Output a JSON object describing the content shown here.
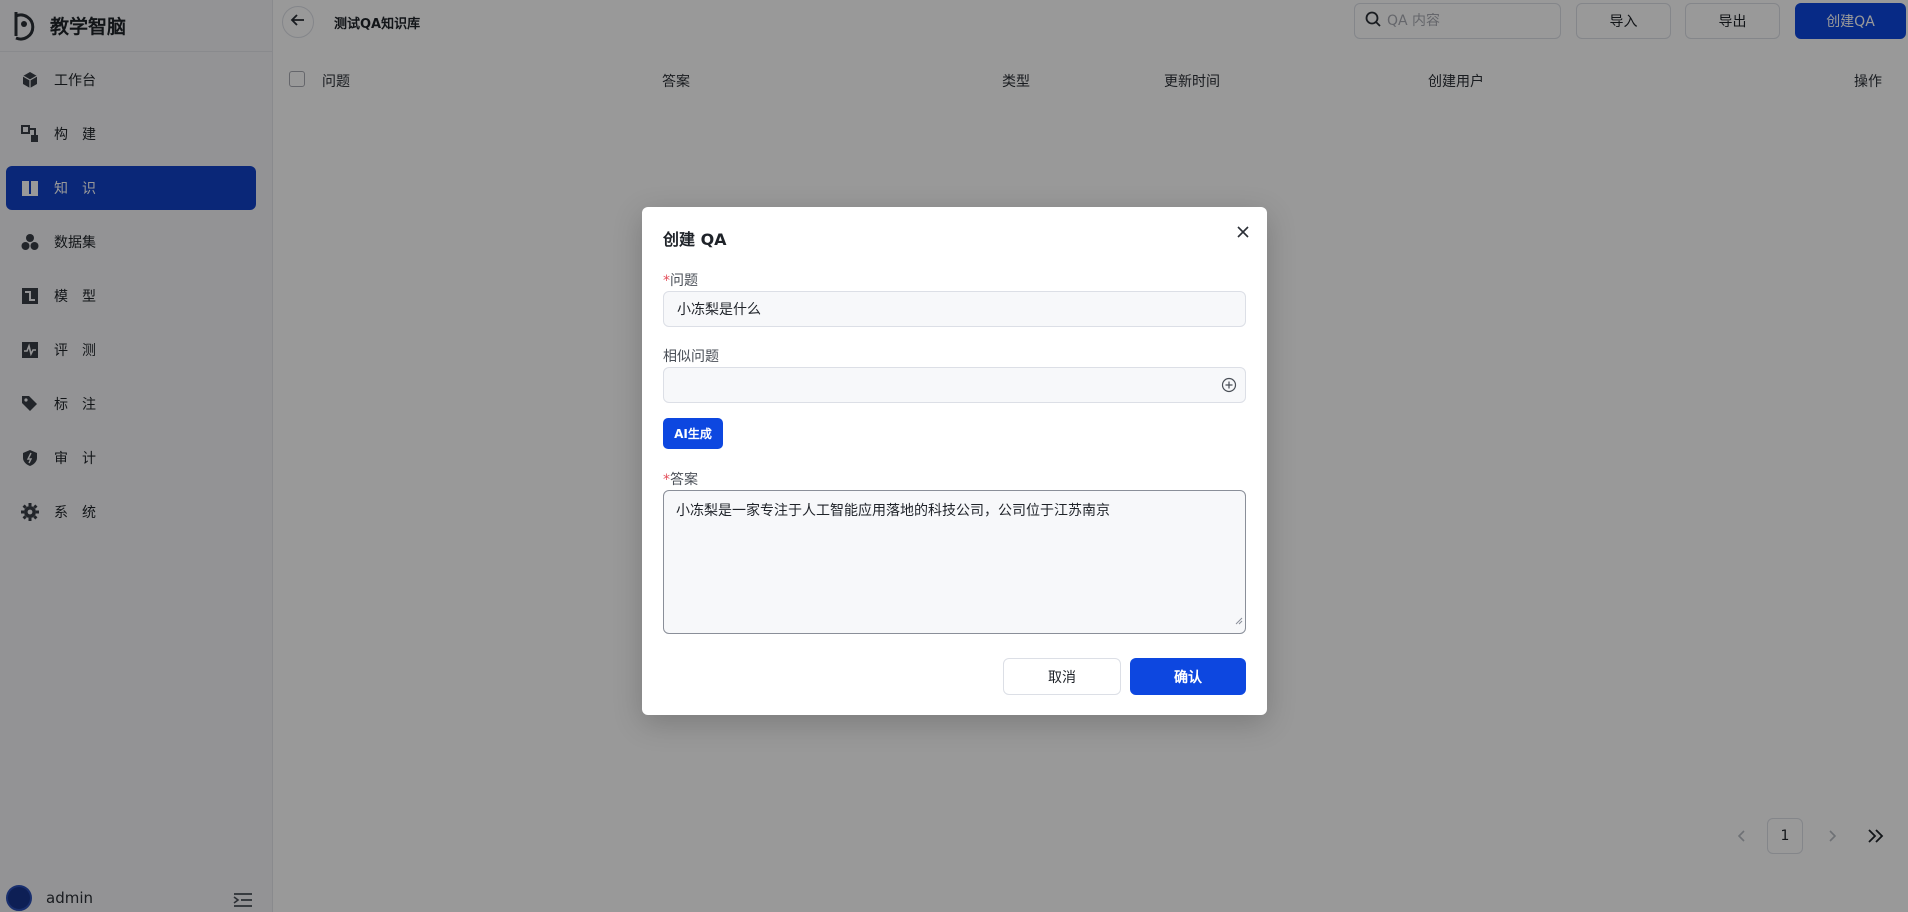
{
  "app": {
    "name": "教学智脑"
  },
  "sidebar": {
    "items": [
      {
        "label": "工作台",
        "icon": "cube-icon",
        "spaced": false,
        "active": false
      },
      {
        "label": "构建",
        "icon": "build-icon",
        "spaced": true,
        "active": false
      },
      {
        "label": "知识",
        "icon": "book-icon",
        "spaced": true,
        "active": true
      },
      {
        "label": "数据集",
        "icon": "cluster-icon",
        "spaced": false,
        "active": false
      },
      {
        "label": "模型",
        "icon": "model-icon",
        "spaced": true,
        "active": false
      },
      {
        "label": "评测",
        "icon": "pulse-icon",
        "spaced": true,
        "active": false
      },
      {
        "label": "标注",
        "icon": "tag-icon",
        "spaced": true,
        "active": false
      },
      {
        "label": "审计",
        "icon": "shield-icon",
        "spaced": true,
        "active": false
      },
      {
        "label": "系统",
        "icon": "gear-icon",
        "spaced": true,
        "active": false
      }
    ],
    "user": {
      "name": "admin"
    }
  },
  "header": {
    "title": "测试QA知识库",
    "search_placeholder": "QA 内容",
    "import_label": "导入",
    "export_label": "导出",
    "create_label": "创建QA"
  },
  "table": {
    "columns": [
      "问题",
      "答案",
      "类型",
      "更新时间",
      "创建用户",
      "操作"
    ]
  },
  "pagination": {
    "current_page": "1"
  },
  "modal": {
    "title": "创建 QA",
    "question_label": "问题",
    "question_value": "小冻梨是什么",
    "similar_label": "相似问题",
    "similar_value": "",
    "ai_button": "AI生成",
    "answer_label": "答案",
    "answer_value": "小冻梨是一家专注于人工智能应用落地的科技公司，公司位于江苏南京",
    "required_mark": "*",
    "cancel_label": "取消",
    "confirm_label": "确认"
  },
  "colors": {
    "primary": "#0d47e0",
    "sidebar_active": "#1142c9",
    "required": "#e34d59"
  }
}
